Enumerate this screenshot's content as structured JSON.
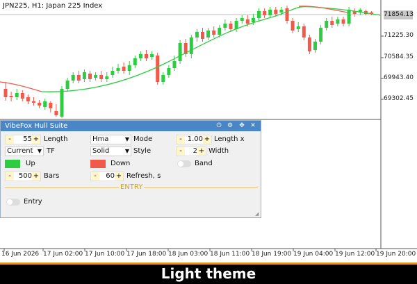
{
  "chart": {
    "symbol": "JPN225, H1:  Japan 225 Index",
    "current_price": "71854.13",
    "y_labels": [
      "71225.30",
      "70584.35",
      "69943.40",
      "69302.45"
    ],
    "x_labels": [
      "16 Jun 2026",
      "17 Jun 02:00",
      "17 Jun 10:00",
      "17 Jun 18:00",
      "18 Jun 03:00",
      "18 Jun 11:00",
      "18 Jun 19:00",
      "19 Jun 04:00",
      "19 Jun 12:00",
      "19 Jun 20:00"
    ],
    "colors": {
      "up": "#2ecc40",
      "down": "#f15a4a",
      "hull_up": "#2ecc40",
      "hull_down": "#f15a4a"
    }
  },
  "panel": {
    "title": "VibeFox Hull Suite",
    "icons": [
      "power-icon",
      "gear-icon",
      "move-icon",
      "close-icon"
    ],
    "length": {
      "value": "55",
      "label": "Length"
    },
    "mode": {
      "value": "Hma",
      "label": "Mode"
    },
    "length_x": {
      "value": "1.00",
      "label": "Length x"
    },
    "tf": {
      "value": "Current",
      "label": "TF"
    },
    "style": {
      "value": "Solid",
      "label": "Style"
    },
    "width": {
      "value": "2",
      "label": "Width"
    },
    "up": {
      "label": "Up",
      "color": "#2ecc40"
    },
    "down": {
      "label": "Down",
      "color": "#f15a4a"
    },
    "band": {
      "label": "Band",
      "on": false
    },
    "bars": {
      "value": "500",
      "label": "Bars"
    },
    "refresh": {
      "value": "60",
      "label": "Refresh, s"
    },
    "entry_header": "ENTRY",
    "entry": {
      "label": "Entry",
      "on": false
    },
    "minus": "-",
    "plus": "+"
  },
  "banner": "Light theme"
}
